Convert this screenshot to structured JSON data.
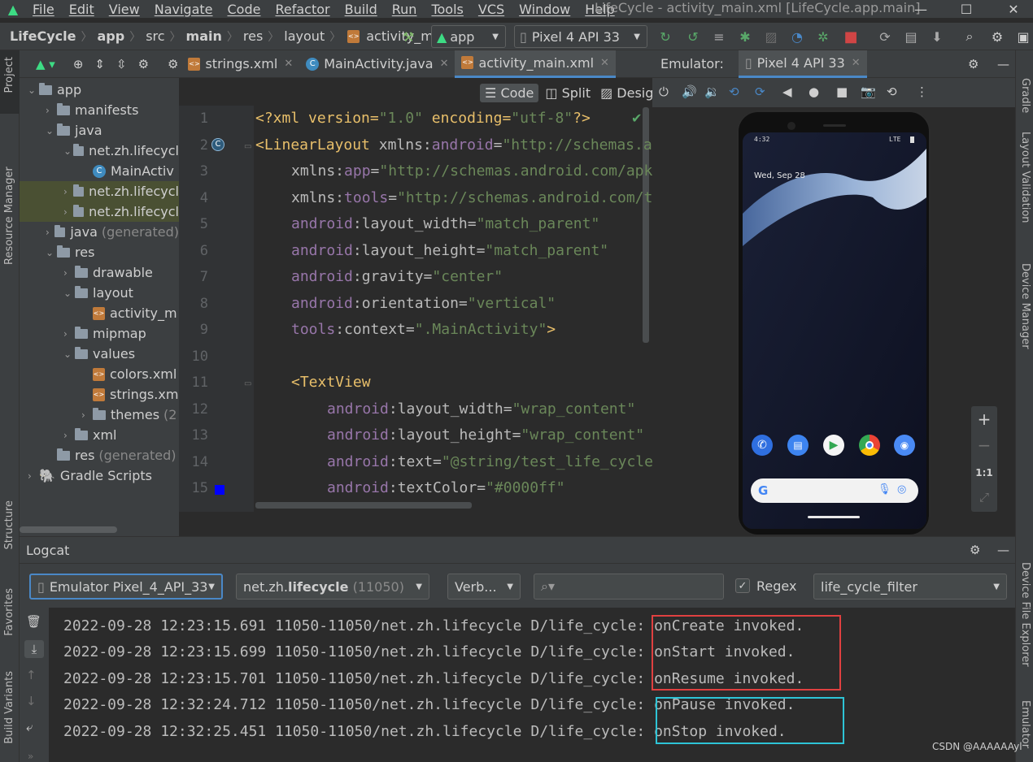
{
  "window": {
    "title": "LifeCycle - activity_main.xml [LifeCycle.app.main]",
    "menu": [
      "File",
      "Edit",
      "View",
      "Navigate",
      "Code",
      "Refactor",
      "Build",
      "Run",
      "Tools",
      "VCS",
      "Window",
      "Help"
    ]
  },
  "breadcrumb": [
    "LifeCycle",
    "app",
    "src",
    "main",
    "res",
    "layout",
    "activity_main.x"
  ],
  "toolbar": {
    "run_config": "app",
    "device": "Pixel 4 API 33"
  },
  "left_strip": [
    "Project",
    "Resource Manager",
    "Structure",
    "Favorites",
    "Build Variants"
  ],
  "right_strip": [
    "Gradle",
    "Layout Validation",
    "Device Manager",
    "Device File Explorer",
    "Emulator"
  ],
  "project_tree": [
    {
      "label": "app",
      "suffix": "",
      "indent": 0,
      "arrow": "⌄",
      "icon": "folder"
    },
    {
      "label": "manifests",
      "suffix": "",
      "indent": 1,
      "arrow": "›",
      "icon": "folder"
    },
    {
      "label": "java",
      "suffix": "",
      "indent": 1,
      "arrow": "⌄",
      "icon": "folder"
    },
    {
      "label": "net.zh.lifecycl",
      "suffix": "",
      "indent": 2,
      "arrow": "⌄",
      "icon": "folder"
    },
    {
      "label": "MainActiv",
      "suffix": "",
      "indent": 3,
      "arrow": "",
      "icon": "class"
    },
    {
      "label": "net.zh.lifecycl",
      "suffix": "",
      "indent": 2,
      "arrow": "›",
      "icon": "folder"
    },
    {
      "label": "net.zh.lifecycl",
      "suffix": "",
      "indent": 2,
      "arrow": "›",
      "icon": "folder"
    },
    {
      "label": "java",
      "suffix": "(generated)",
      "indent": 1,
      "arrow": "›",
      "icon": "folder"
    },
    {
      "label": "res",
      "suffix": "",
      "indent": 1,
      "arrow": "⌄",
      "icon": "folder"
    },
    {
      "label": "drawable",
      "suffix": "",
      "indent": 2,
      "arrow": "›",
      "icon": "folder"
    },
    {
      "label": "layout",
      "suffix": "",
      "indent": 2,
      "arrow": "⌄",
      "icon": "folder"
    },
    {
      "label": "activity_m",
      "suffix": "",
      "indent": 3,
      "arrow": "",
      "icon": "xml"
    },
    {
      "label": "mipmap",
      "suffix": "",
      "indent": 2,
      "arrow": "›",
      "icon": "folder"
    },
    {
      "label": "values",
      "suffix": "",
      "indent": 2,
      "arrow": "⌄",
      "icon": "folder"
    },
    {
      "label": "colors.xml",
      "suffix": "",
      "indent": 3,
      "arrow": "",
      "icon": "xml"
    },
    {
      "label": "strings.xm",
      "suffix": "",
      "indent": 3,
      "arrow": "",
      "icon": "xml"
    },
    {
      "label": "themes",
      "suffix": "(2",
      "indent": 3,
      "arrow": "›",
      "icon": "folder"
    },
    {
      "label": "xml",
      "suffix": "",
      "indent": 2,
      "arrow": "›",
      "icon": "folder"
    },
    {
      "label": "res",
      "suffix": "(generated)",
      "indent": 1,
      "arrow": "",
      "icon": "folder"
    },
    {
      "label": "Gradle Scripts",
      "suffix": "",
      "indent": 0,
      "arrow": "›",
      "icon": "gradle"
    }
  ],
  "editor_tabs": [
    {
      "label": "strings.xml",
      "active": false,
      "icon": "xml"
    },
    {
      "label": "MainActivity.java",
      "active": false,
      "icon": "class"
    },
    {
      "label": "activity_main.xml",
      "active": true,
      "icon": "xml"
    }
  ],
  "view_modes": [
    "Code",
    "Split",
    "Design"
  ],
  "code_lines": [
    "1",
    "2",
    "3",
    "4",
    "5",
    "6",
    "7",
    "8",
    "9",
    "10",
    "11",
    "12",
    "13",
    "14",
    "15"
  ],
  "code": {
    "l1": {
      "a": "<?xml version=",
      "b": "\"1.0\"",
      "c": " encoding=",
      "d": "\"utf-8\"",
      "e": "?>"
    },
    "l2": {
      "tag": "<LinearLayout",
      "attr": " xmlns:",
      "ns": "android",
      "eq": "=",
      "val": "\"http://schemas.a"
    },
    "l3": {
      "attr": "xmlns:",
      "ns": "app",
      "eq": "=",
      "val": "\"http://schemas.android.com/apk"
    },
    "l4": {
      "attr": "xmlns:",
      "ns": "tools",
      "eq": "=",
      "val": "\"http://schemas.android.com/t"
    },
    "l5": {
      "ns": "android",
      "attr": ":layout_width=",
      "val": "\"match_parent\""
    },
    "l6": {
      "ns": "android",
      "attr": ":layout_height=",
      "val": "\"match_parent\""
    },
    "l7": {
      "ns": "android",
      "attr": ":gravity=",
      "val": "\"center\""
    },
    "l8": {
      "ns": "android",
      "attr": ":orientation=",
      "val": "\"vertical\""
    },
    "l9": {
      "ns": "tools",
      "attr": ":context=",
      "val": "\".MainActivity\"",
      "end": ">"
    },
    "l11": {
      "tag": "<TextView"
    },
    "l12": {
      "ns": "android",
      "attr": ":layout_width=",
      "val": "\"wrap_content\""
    },
    "l13": {
      "ns": "android",
      "attr": ":layout_height=",
      "val": "\"wrap_content\""
    },
    "l14": {
      "ns": "android",
      "attr": ":text=",
      "val": "\"@string/test_life_cycle"
    },
    "l15": {
      "ns": "android",
      "attr": ":textColor=",
      "val": "\"#0000ff\""
    }
  },
  "emulator": {
    "label": "Emulator:",
    "device_tab": "Pixel 4 API 33",
    "status_time": "4:32",
    "status_net": "LTE",
    "date": "Wed, Sep 28",
    "zoom_one": "1:1"
  },
  "logcat": {
    "title": "Logcat",
    "device": "Emulator Pixel_4_API_33",
    "process_name": "net.zh.",
    "process_bold": "lifecycle",
    "process_pid": "(11050)",
    "level": "Verb...",
    "search_placeholder": "",
    "regex_label": "Regex",
    "regex_checked": true,
    "filter": "life_cycle_filter",
    "lines": [
      {
        "prefix": "2022-09-28 12:23:15.691 11050-11050/net.zh.lifecycle D/life_cycle: ",
        "msg": "onCreate invoked."
      },
      {
        "prefix": "2022-09-28 12:23:15.699 11050-11050/net.zh.lifecycle D/life_cycle: ",
        "msg": "onStart invoked."
      },
      {
        "prefix": "2022-09-28 12:23:15.701 11050-11050/net.zh.lifecycle D/life_cycle: ",
        "msg": "onResume invoked."
      },
      {
        "prefix": "2022-09-28 12:32:24.712 11050-11050/net.zh.lifecycle D/life_cycle: ",
        "msg": "onPause invoked."
      },
      {
        "prefix": "2022-09-28 12:32:25.451 11050-11050/net.zh.lifecycle D/life_cycle: ",
        "msg": "onStop invoked."
      }
    ]
  },
  "watermark": "CSDN @AAAAAAyl",
  "colors": {
    "highlight_red": "#e04040",
    "highlight_cyan": "#2ec4d6",
    "accent": "#4a88c7"
  }
}
